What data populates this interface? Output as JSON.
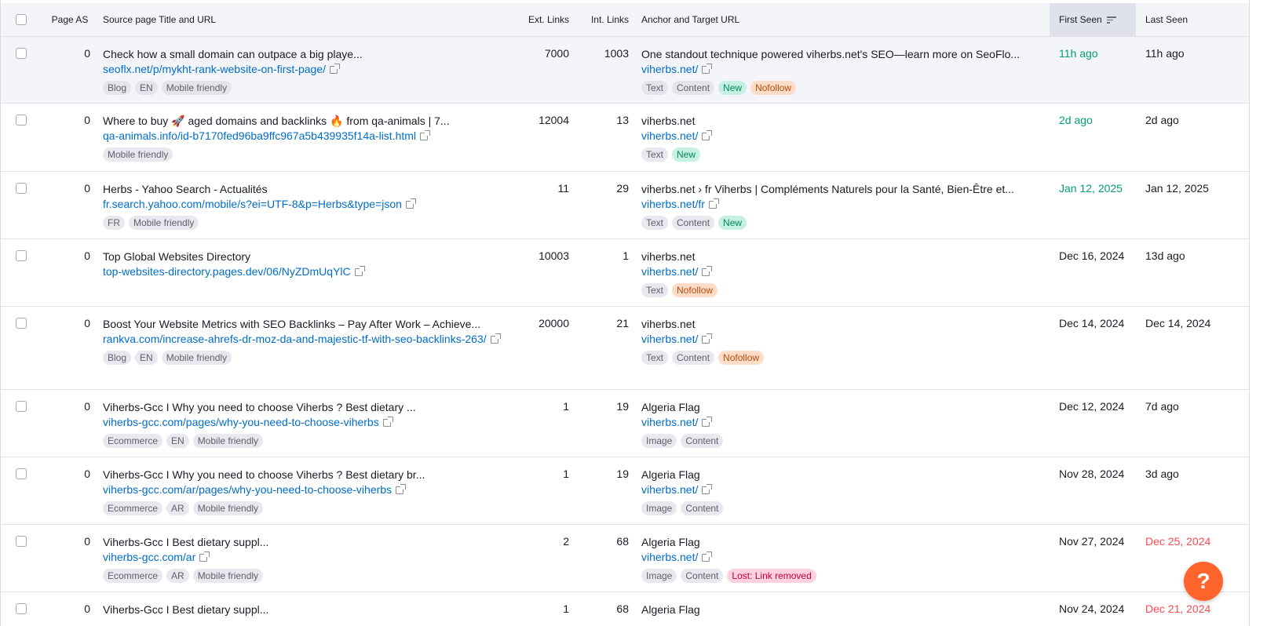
{
  "header": {
    "page_as": "Page AS",
    "source": "Source page Title and URL",
    "ext_links": "Ext. Links",
    "int_links": "Int. Links",
    "anchor": "Anchor and Target URL",
    "first_seen": "First Seen",
    "last_seen": "Last Seen"
  },
  "rows": [
    {
      "page_as": "0",
      "title": "Check how a small domain can outpace a big playe...",
      "url": "seoflx.net/p/mykht-rank-website-on-first-page/",
      "source_tags": [
        "Blog",
        "EN",
        "Mobile friendly"
      ],
      "ext_links": "7000",
      "int_links": "1003",
      "anchor": "One standout technique powered viherbs.net's SEO—learn more on SeoFlo...",
      "target_url": "viherbs.net/",
      "anchor_tags": [
        "Text",
        "Content",
        "New",
        "Nofollow"
      ],
      "first_seen": "11h ago",
      "last_seen": "11h ago"
    },
    {
      "page_as": "0",
      "title": "Where to buy 🚀 aged domains and backlinks 🔥 from qa-animals | 7...",
      "url": "qa-animals.info/id-b7170fed96ba9ffc967a5b439935f14a-list.html",
      "source_tags": [
        "Mobile friendly"
      ],
      "ext_links": "12004",
      "int_links": "13",
      "anchor": "viherbs.net",
      "target_url": "viherbs.net/",
      "anchor_tags": [
        "Text",
        "New"
      ],
      "first_seen": "2d ago",
      "last_seen": "2d ago"
    },
    {
      "page_as": "0",
      "title": "Herbs - Yahoo Search - Actualités",
      "url": "fr.search.yahoo.com/mobile/s?ei=UTF-8&p=Herbs&type=json",
      "source_tags": [
        "FR",
        "Mobile friendly"
      ],
      "ext_links": "11",
      "int_links": "29",
      "anchor": "viherbs.net › fr Viherbs | Compléments Naturels pour la Santé, Bien-Être et...",
      "target_url": "viherbs.net/fr",
      "anchor_tags": [
        "Text",
        "Content",
        "New"
      ],
      "first_seen": "Jan 12, 2025",
      "last_seen": "Jan 12, 2025"
    },
    {
      "page_as": "0",
      "title": "Top Global Websites Directory",
      "url": "top-websites-directory.pages.dev/06/NyZDmUqYlC",
      "source_tags": [],
      "ext_links": "10003",
      "int_links": "1",
      "anchor": "viherbs.net",
      "target_url": "viherbs.net/",
      "anchor_tags": [
        "Text",
        "Nofollow"
      ],
      "first_seen": "Dec 16, 2024",
      "last_seen": "13d ago"
    },
    {
      "page_as": "0",
      "title": "Boost Your Website Metrics with SEO Backlinks – Pay After Work – Achieve...",
      "url": "rankva.com/increase-ahrefs-dr-moz-da-and-majestic-tf-with-seo-backlinks-263/",
      "source_tags": [
        "Blog",
        "EN",
        "Mobile friendly"
      ],
      "ext_links": "20000",
      "int_links": "21",
      "anchor": "viherbs.net",
      "target_url": "viherbs.net/",
      "anchor_tags": [
        "Text",
        "Content",
        "Nofollow"
      ],
      "first_seen": "Dec 14, 2024",
      "last_seen": "Dec 14, 2024"
    },
    {
      "page_as": "0",
      "title": "Viherbs-Gcc I Why you need to choose Viherbs ? Best dietary ...",
      "url": "viherbs-gcc.com/pages/why-you-need-to-choose-viherbs",
      "source_tags": [
        "Ecommerce",
        "EN",
        "Mobile friendly"
      ],
      "ext_links": "1",
      "int_links": "19",
      "anchor": "Algeria Flag",
      "target_url": "viherbs.net/",
      "anchor_tags": [
        "Image",
        "Content"
      ],
      "first_seen": "Dec 12, 2024",
      "last_seen": "7d ago"
    },
    {
      "page_as": "0",
      "title": "Viherbs-Gcc I Why you need to choose Viherbs ? Best dietary br...",
      "url": "viherbs-gcc.com/ar/pages/why-you-need-to-choose-viherbs",
      "source_tags": [
        "Ecommerce",
        "AR",
        "Mobile friendly"
      ],
      "ext_links": "1",
      "int_links": "19",
      "anchor": "Algeria Flag",
      "target_url": "viherbs.net/",
      "anchor_tags": [
        "Image",
        "Content"
      ],
      "first_seen": "Nov 28, 2024",
      "last_seen": "3d ago"
    },
    {
      "page_as": "0",
      "title": "Viherbs-Gcc I Best dietary suppl...",
      "url": "viherbs-gcc.com/ar",
      "source_tags": [
        "Ecommerce",
        "AR",
        "Mobile friendly"
      ],
      "ext_links": "2",
      "int_links": "68",
      "anchor": "Algeria Flag",
      "target_url": "viherbs.net/",
      "anchor_tags": [
        "Image",
        "Content",
        "Lost: Link removed"
      ],
      "first_seen": "Nov 27, 2024",
      "last_seen": "Dec 25, 2024"
    },
    {
      "page_as": "0",
      "title": "Viherbs-Gcc I Best dietary suppl...",
      "url": "",
      "source_tags": [],
      "ext_links": "1",
      "int_links": "68",
      "anchor": "Algeria Flag",
      "target_url": "",
      "anchor_tags": [],
      "first_seen": "Nov 24, 2024",
      "last_seen": "Dec 21, 2024"
    }
  ],
  "help_button": {
    "label": "?"
  },
  "colors": {
    "link": "#006dca",
    "recent_green": "#009f76",
    "lost_red": "#ff4953",
    "help_orange": "#ff642d",
    "new_tag": "#c6f0e4",
    "nofollow_tag": "#ffdcc8",
    "lost_tag": "#ffd2de"
  }
}
